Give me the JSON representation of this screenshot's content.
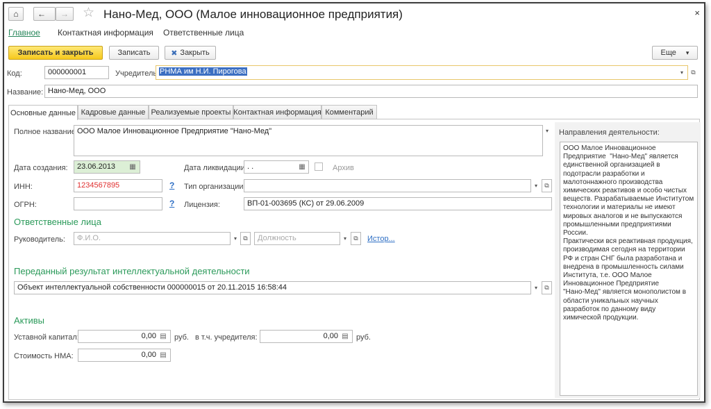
{
  "window": {
    "title": "Нано-Мед, ООО (Малое инновационное предприятия)",
    "nav_home": "⌂",
    "nav_back": "←",
    "nav_forward": "→",
    "star": "☆",
    "close": "×"
  },
  "sections": {
    "main": "Главное",
    "contact": "Контактная информация",
    "responsible": "Ответственные лица"
  },
  "toolbar": {
    "save_close": "Записать и закрыть",
    "save": "Записать",
    "close_icon": "✖",
    "close": "Закрыть",
    "more": "Еще",
    "more_arrow": "▾"
  },
  "header_fields": {
    "code_label": "Код:",
    "code_value": "000000001",
    "founder_label": "Учредитель:",
    "founder_value": "РНМА им Н.И. Пирогова",
    "name_label": "Название:",
    "name_value": "Нано-Мед, ООО"
  },
  "tabs": [
    {
      "label": "Основные данные"
    },
    {
      "label": "Кадровые данные"
    },
    {
      "label": "Реализуемые проекты"
    },
    {
      "label": "Контактная информация"
    },
    {
      "label": "Комментарий"
    }
  ],
  "main_tab": {
    "full_name_label": "Полное название:",
    "full_name_value": "ООО Малое Инновационное Предприятие  \"Нано-Мед\"",
    "created_label": "Дата создания:",
    "created_value": "23.06.2013",
    "liquidation_label": "Дата ликвидации:",
    "liquidation_value": " .  .",
    "archive_label": "Архив",
    "inn_label": "ИНН:",
    "inn_value": "1234567895",
    "help_mark": "?",
    "org_type_label": "Тип организации:",
    "org_type_value": "",
    "ogrn_label": "ОГРН:",
    "ogrn_value": "",
    "license_label": "Лицензия:",
    "license_value": "ВП-01-003695 (КС) от 29.06.2009",
    "responsible_heading": "Ответственные лица",
    "manager_label": "Руководитель:",
    "manager_placeholder": "Ф.И.О.",
    "position_placeholder": "Должность",
    "history_link": "Истор...",
    "result_heading": "Переданный результат интеллектуальной деятельности",
    "result_value": "Объект интеллектуальной собственности 000000015 от 20.11.2015 16:58:44",
    "assets_heading": "Активы",
    "capital_label": "Уставной капитал:",
    "capital_value": "0,00",
    "currency": "руб.",
    "founder_share_label": "в т.ч. учредителя:",
    "founder_share_value": "0,00",
    "nma_label": "Стоимость НМА:",
    "nma_value": "0,00"
  },
  "activity": {
    "label": "Направления деятельности:",
    "text": "ООО Малое Инновационное\nПредприятие  \"Нано-Мед\" является\nединственной организацией в\nподотрасли разработки и\nмалотоннажного производства\nхимических реактивов и особо чистых\nвеществ. Разрабатываемые Институтом\nтехнологии и материалы не имеют\nмировых аналогов и не выпускаются\nпромышленными предприятиями\nРоссии.\nПрактически вся реактивная продукция,\nпроизводимая сегодня на территории\nРФ и стран СНГ была разработана и\nвнедрена в промышленность силами\nИнститута, т.е. ООО Малое\nИнновационное Предприятие\n\"Нано-Мед\" является монополистом в\nобласти уникальных научных\nразработок по данному виду\nхимической продукции."
  },
  "icons": {
    "dropdown": "▾",
    "open": "⧉",
    "calendar": "▦",
    "calculator": "▤"
  },
  "colors": {
    "accent_green": "#2b9a5a",
    "primary_button": "#f6c91d",
    "link_blue": "#2d6ec4",
    "inn_red": "#e03030"
  }
}
